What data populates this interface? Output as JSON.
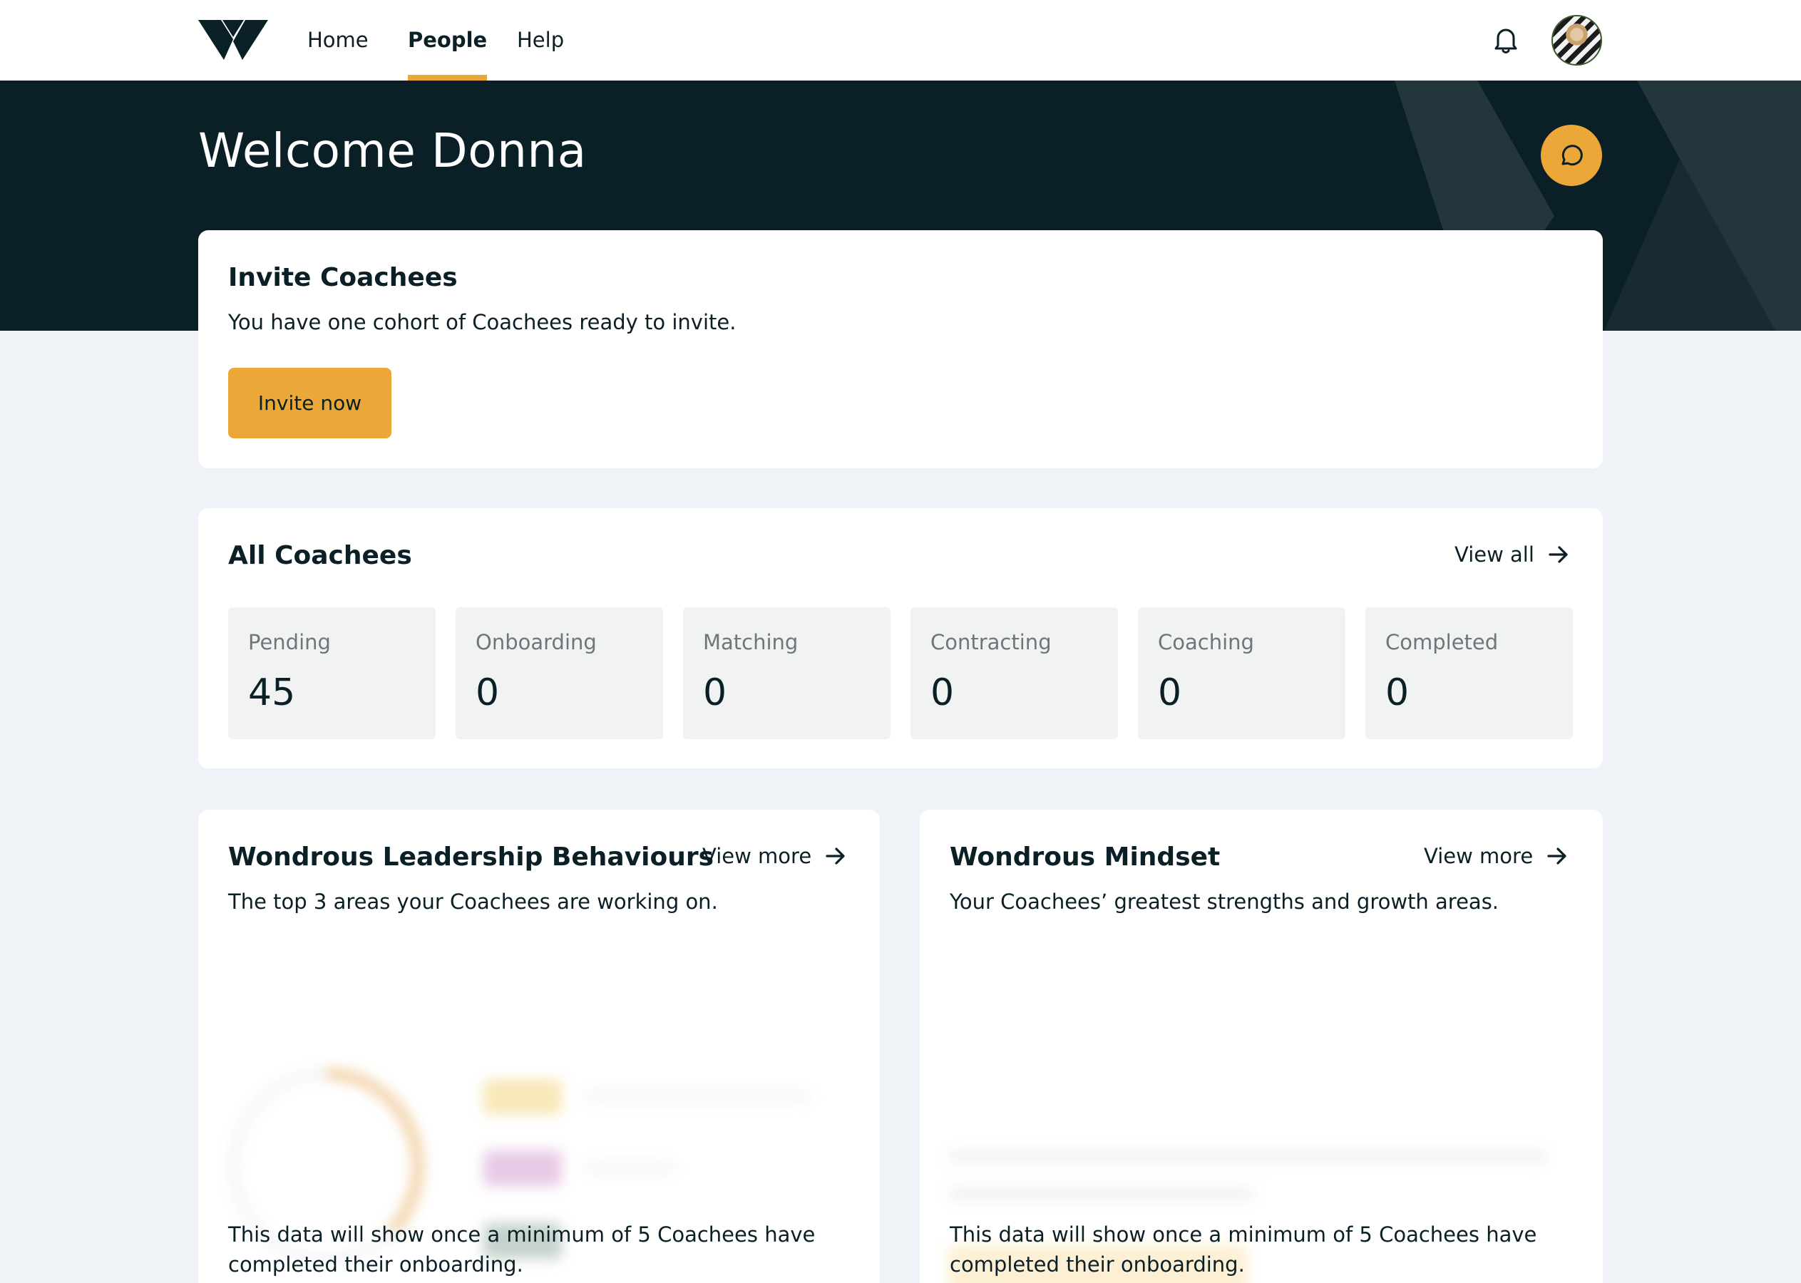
{
  "nav": {
    "items": [
      {
        "label": "Home",
        "active": false
      },
      {
        "label": "People",
        "active": true
      },
      {
        "label": "Help",
        "active": false
      }
    ]
  },
  "hero": {
    "title": "Welcome Donna"
  },
  "invite": {
    "title": "Invite Coachees",
    "text": "You have one cohort of Coachees ready to invite.",
    "button": "Invite now"
  },
  "all_coachees": {
    "title": "All Coachees",
    "view_all": "View all",
    "stats": [
      {
        "label": "Pending",
        "value": "45"
      },
      {
        "label": "Onboarding",
        "value": "0"
      },
      {
        "label": "Matching",
        "value": "0"
      },
      {
        "label": "Contracting",
        "value": "0"
      },
      {
        "label": "Coaching",
        "value": "0"
      },
      {
        "label": "Completed",
        "value": "0"
      }
    ]
  },
  "leadership": {
    "title": "Wondrous Leadership Behaviours",
    "view_more": "View more",
    "subtitle": "The top 3 areas your Coachees are working on.",
    "notice": "This data will show once a minimum of 5 Coachees have completed their onboarding."
  },
  "mindset": {
    "title": "Wondrous Mindset",
    "view_more": "View more",
    "subtitle": "Your Coachees’ greatest strengths and growth areas.",
    "notice": "This data will show once a minimum of 5 Coachees have completed their onboarding."
  },
  "colors": {
    "accent": "#eba838",
    "dark": "#0b1f26",
    "page_bg": "#eff2f6",
    "stat_bg": "#f1f3f3"
  },
  "icons": [
    "logo-icon",
    "bell-icon",
    "chat-icon",
    "arrow-right-icon"
  ]
}
